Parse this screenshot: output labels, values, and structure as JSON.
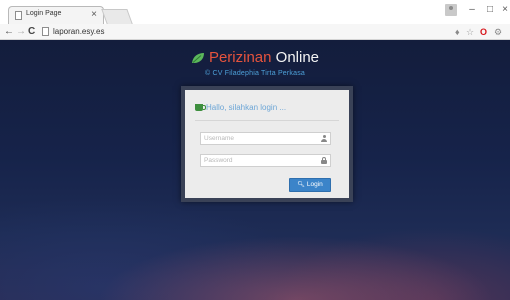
{
  "browser": {
    "tab_title": "Login Page",
    "tab_close": "×",
    "url": "laporan.esy.es",
    "nav": {
      "back": "←",
      "forward": "→",
      "reload": "C"
    },
    "window_controls": {
      "minimize": "–",
      "maximize": "□",
      "close": "×"
    },
    "toolbar_icons": {
      "extension": "♦",
      "star": "☆",
      "opera": "O",
      "settings": "⚙"
    }
  },
  "brand": {
    "name_red": "Perizinan",
    "name_white": " Online",
    "subtitle": "© CV Filadephia Tirta Perkasa",
    "accent_red": "#e5533d",
    "accent_blue": "#4da0d8"
  },
  "login": {
    "heading": "Hallo, silahkan login ...",
    "username_placeholder": "Username",
    "password_placeholder": "Password",
    "button_label": "Login",
    "button_icon": "key-icon",
    "button_color": "#3b84c9"
  }
}
